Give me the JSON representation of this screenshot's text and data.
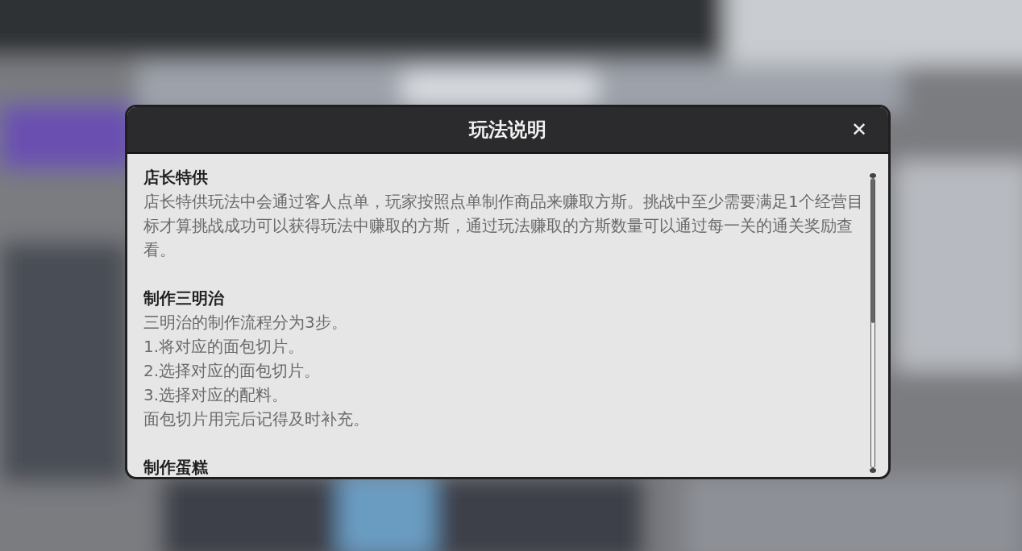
{
  "dialog": {
    "title": "玩法说明",
    "close": "✕",
    "sections": [
      {
        "heading": "店长特供",
        "lines": [
          "店长特供玩法中会通过客人点单，玩家按照点单制作商品来赚取方斯。挑战中至少需要满足1个经营目标才算挑战成功可以获得玩法中赚取的方斯，通过玩法赚取的方斯数量可以通过每一关的通关奖励查看。"
        ]
      },
      {
        "heading": "制作三明治",
        "lines": [
          "三明治的制作流程分为3步。",
          "1.将对应的面包切片。",
          "2.选择对应的面包切片。",
          "3.选择对应的配料。",
          "面包切片用完后记得及时补充。"
        ]
      },
      {
        "heading": "制作蛋糕"
      }
    ]
  }
}
